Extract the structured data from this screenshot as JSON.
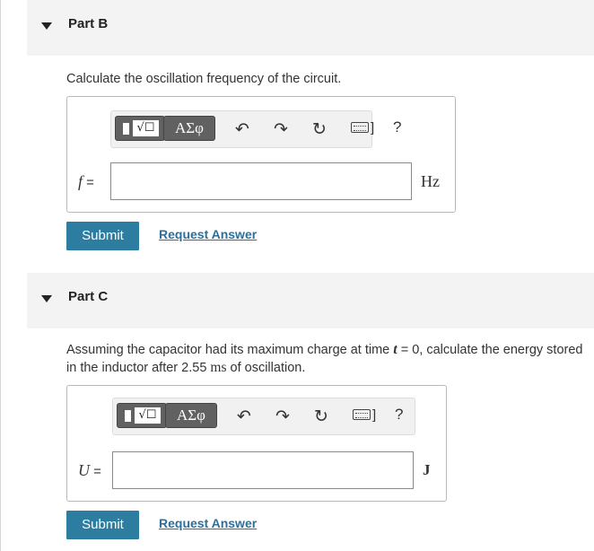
{
  "partB": {
    "title": "Part B",
    "question": "Calculate the oscillation frequency of the circuit.",
    "toolbar": {
      "templates_symbol": "√☐",
      "greek_label": "AΣφ",
      "undo_icon": "undo-icon",
      "redo_icon": "redo-icon",
      "reset_icon": "reset-icon",
      "keyboard_icon": "keyboard-icon",
      "help_label": "?"
    },
    "variable": "f",
    "equals": " =",
    "input_value": "",
    "unit": "Hz",
    "submit_label": "Submit",
    "request_label": "Request Answer"
  },
  "partC": {
    "title": "Part C",
    "question_pre": "Assuming the capacitor had its maximum charge at time ",
    "question_var": "t",
    "question_mid": " = 0, calculate the energy stored in the inductor after 2.55 ",
    "question_unit": "ms",
    "question_post": " of oscillation.",
    "toolbar": {
      "templates_symbol": "√☐",
      "greek_label": "AΣφ",
      "undo_icon": "undo-icon",
      "redo_icon": "redo-icon",
      "reset_icon": "reset-icon",
      "keyboard_icon": "keyboard-icon",
      "help_label": "?"
    },
    "variable": "U",
    "equals": " =",
    "input_value": "",
    "unit": "J",
    "submit_label": "Submit",
    "request_label": "Request Answer"
  }
}
